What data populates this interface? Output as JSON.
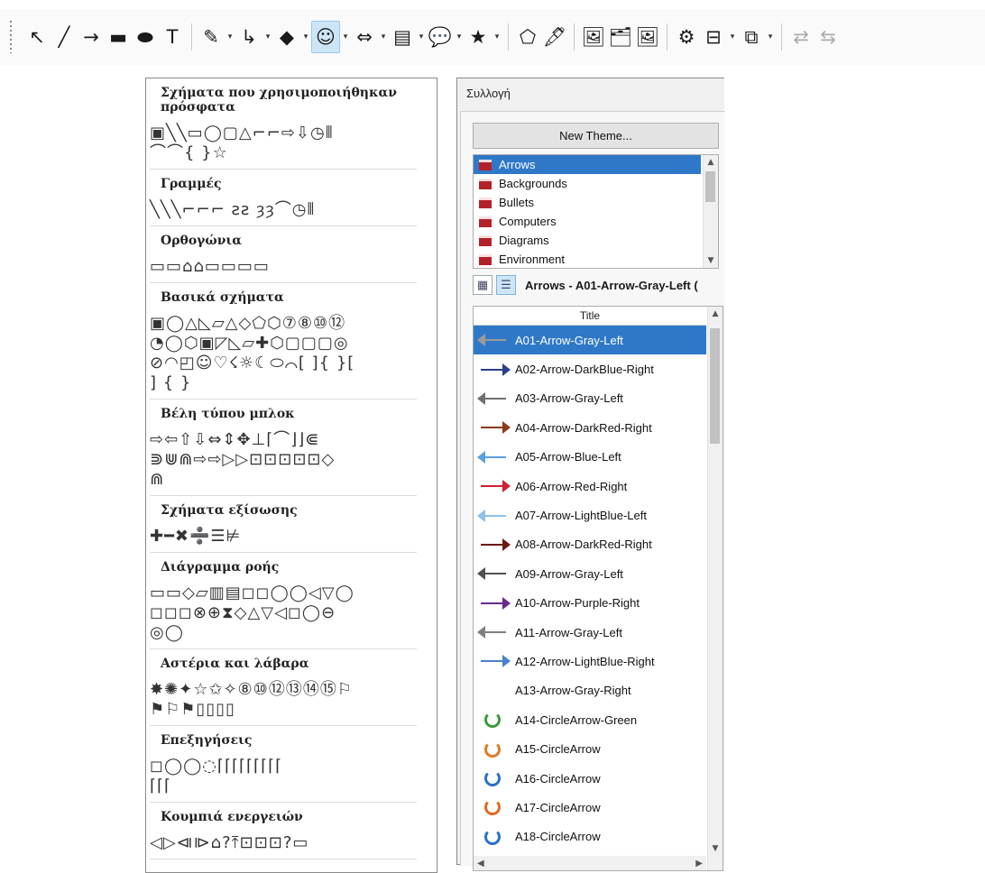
{
  "toolbar": {
    "buttons": [
      {
        "name": "select-icon",
        "glyph": "↖"
      },
      {
        "name": "line-icon",
        "glyph": "╱"
      },
      {
        "name": "arrow-line-icon",
        "glyph": "→"
      },
      {
        "name": "rectangle-icon",
        "glyph": "▬"
      },
      {
        "name": "ellipse-icon",
        "glyph": "⬬"
      },
      {
        "name": "text-icon",
        "glyph": "T"
      },
      {
        "name": "curve-icon",
        "glyph": "✎",
        "dropdown": true
      },
      {
        "name": "connector-icon",
        "glyph": "↳",
        "dropdown": true
      },
      {
        "name": "basic-shapes-icon",
        "glyph": "◆",
        "dropdown": true
      },
      {
        "name": "symbol-shapes-icon",
        "glyph": "☺",
        "dropdown": true,
        "active": true
      },
      {
        "name": "block-arrows-icon",
        "glyph": "⇔",
        "dropdown": true
      },
      {
        "name": "flowchart-icon",
        "glyph": "▤",
        "dropdown": true
      },
      {
        "name": "callout-icon",
        "glyph": "💬",
        "dropdown": true
      },
      {
        "name": "stars-icon",
        "glyph": "★",
        "dropdown": true
      },
      {
        "name": "points-icon",
        "glyph": "⬠"
      },
      {
        "name": "fontwork-icon",
        "glyph": "🖋"
      },
      {
        "name": "from-file-icon",
        "glyph": "🖼"
      },
      {
        "name": "gallery-icon",
        "glyph": "🗂"
      },
      {
        "name": "insert-image-icon",
        "glyph": "🖼"
      },
      {
        "name": "extrusion-icon",
        "glyph": "⚙"
      },
      {
        "name": "align-icon",
        "glyph": "⊟",
        "dropdown": true
      },
      {
        "name": "arrange-icon",
        "glyph": "⧉",
        "dropdown": true
      },
      {
        "name": "disabled-1-icon",
        "glyph": "⇄",
        "disabled": true
      },
      {
        "name": "disabled-2-icon",
        "glyph": "⇆",
        "disabled": true
      }
    ]
  },
  "shapes_panel": {
    "sections": [
      {
        "title": "Σχήματα που χρησιμοποιήθηκαν πρόσφατα",
        "rows": [
          "▣╲╲▭◯▢△⌐⌐⇨⇩◷⦀",
          "⌒⌒{ }☆"
        ]
      },
      {
        "title": "Γραμμές",
        "rows": [
          "╲╲╲⌐⌐⌐ ƨƨ ȝȝ⌒◷⦀"
        ]
      },
      {
        "title": "Ορθογώνια",
        "rows": [
          "▭▭⌂⌂▭▭▭▭"
        ]
      },
      {
        "title": "Βασικά σχήματα",
        "rows": [
          "▣◯△◺▱△◇⬠⬡⑦⑧⑩⑫",
          "◔◯⬡▣◸◺▱✚⬡▢▢▢◎",
          "⊘◠◰☺♡☇☼☾⬭⌒[ ]{ }[",
          "] { }"
        ]
      },
      {
        "title": "Βέλη τύπου μπλοκ",
        "rows": [
          "⇨⇦⇧⇩⇔⇕✥⊥⌈⌒⌋⌋⋐",
          "⋑⋓⋒⇨⇨▷▷⊡⊡⊡⊡⊡◇",
          "⋒"
        ]
      },
      {
        "title": "Σχήματα εξίσωσης",
        "rows": [
          "✚━✖➗☰⊭"
        ]
      },
      {
        "title": "Διάγραμμα ροής",
        "rows": [
          "▭▭◇▱▥▤◻◻◯◯◁▽◯",
          "◻◻◻⊗⊕⧗◇△▽◁◻◯⊖",
          "◎◯"
        ]
      },
      {
        "title": "Αστέρια και λάβαρα",
        "rows": [
          "✸✺✦☆✩✧⑧⑩⑫⑬⑭⑮⚐",
          "⚑⚐⚑▯▯▯▯"
        ]
      },
      {
        "title": "Επεξηγήσεις",
        "rows": [
          "◻◯◯◌⌈⌈⌈⌈⌈⌈⌈⌈⌈",
          "⌈⌈⌈"
        ]
      },
      {
        "title": "Κουμπιά ενεργειών",
        "rows": [
          "◁▷⧏⧐⌂?⤒⊡⊡⊡?▭"
        ]
      }
    ]
  },
  "gallery": {
    "title": "Συλλογή",
    "new_theme_label": "New Theme...",
    "themes": [
      {
        "label": "Arrows",
        "selected": true
      },
      {
        "label": "Backgrounds"
      },
      {
        "label": "Bullets"
      },
      {
        "label": "Computers"
      },
      {
        "label": "Diagrams"
      },
      {
        "label": "Environment"
      }
    ],
    "current_item_label": "Arrows - A01-Arrow-Gray-Left (",
    "column_title": "Title",
    "items": [
      {
        "label": "A01-Arrow-Gray-Left",
        "selected": true,
        "kind": "arrow",
        "color": "#9a9a9a",
        "dir": "left"
      },
      {
        "label": "A02-Arrow-DarkBlue-Right",
        "kind": "arrow",
        "color": "#2a3f8a",
        "dir": "right"
      },
      {
        "label": "A03-Arrow-Gray-Left",
        "kind": "arrow",
        "color": "#707070",
        "dir": "left"
      },
      {
        "label": "A04-Arrow-DarkRed-Right",
        "kind": "arrow",
        "color": "#8b3a1a",
        "dir": "right"
      },
      {
        "label": "A05-Arrow-Blue-Left",
        "kind": "arrow",
        "color": "#5aa0e0",
        "dir": "left"
      },
      {
        "label": "A06-Arrow-Red-Right",
        "kind": "arrow",
        "color": "#d02030",
        "dir": "right"
      },
      {
        "label": "A07-Arrow-LightBlue-Left",
        "kind": "arrow",
        "color": "#8fc0e8",
        "dir": "left"
      },
      {
        "label": "A08-Arrow-DarkRed-Right",
        "kind": "arrow",
        "color": "#6a1a10",
        "dir": "right"
      },
      {
        "label": "A09-Arrow-Gray-Left",
        "kind": "arrow",
        "color": "#505050",
        "dir": "left"
      },
      {
        "label": "A10-Arrow-Purple-Right",
        "kind": "arrow",
        "color": "#6a2a90",
        "dir": "right"
      },
      {
        "label": "A11-Arrow-Gray-Left",
        "kind": "arrow",
        "color": "#808080",
        "dir": "left"
      },
      {
        "label": "A12-Arrow-LightBlue-Right",
        "kind": "arrow",
        "color": "#4a80d0",
        "dir": "right"
      },
      {
        "label": "A13-Arrow-Gray-Right",
        "kind": "none"
      },
      {
        "label": "A14-CircleArrow-Green",
        "kind": "circle",
        "color": "#3a9a3a"
      },
      {
        "label": "A15-CircleArrow",
        "kind": "circle",
        "color": "#e07a20"
      },
      {
        "label": "A16-CircleArrow",
        "kind": "circle",
        "color": "#2a70c8"
      },
      {
        "label": "A17-CircleArrow",
        "kind": "circle",
        "color": "#e06a20"
      },
      {
        "label": "A18-CircleArrow",
        "kind": "circle",
        "color": "#2a70c8"
      }
    ]
  }
}
